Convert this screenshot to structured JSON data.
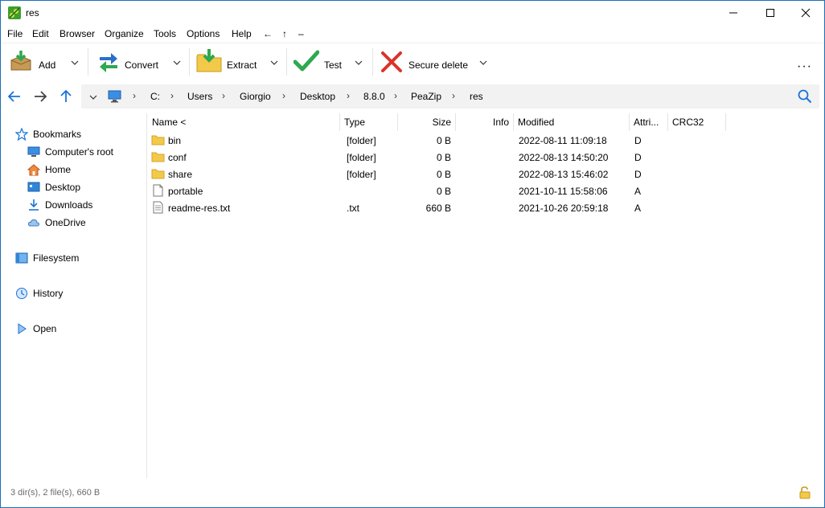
{
  "window": {
    "title": "res"
  },
  "menu": [
    "File",
    "Edit",
    "Browser",
    "Organize",
    "Tools",
    "Options",
    "Help",
    "←",
    "↑",
    "–"
  ],
  "toolbar": {
    "add": "Add",
    "convert": "Convert",
    "extract": "Extract",
    "test": "Test",
    "secure_delete": "Secure delete",
    "more": "···"
  },
  "address": {
    "crumbs": [
      "C:",
      "Users",
      "Giorgio",
      "Desktop",
      "8.8.0",
      "PeaZip",
      "res"
    ]
  },
  "sidebar": {
    "bookmarks": "Bookmarks",
    "items": [
      "Computer's root",
      "Home",
      "Desktop",
      "Downloads",
      "OneDrive"
    ],
    "filesystem": "Filesystem",
    "history": "History",
    "open": "Open"
  },
  "columns": {
    "name": "Name <",
    "type": "Type",
    "size": "Size",
    "info": "Info",
    "modified": "Modified",
    "attri": "Attri...",
    "crc32": "CRC32"
  },
  "files": [
    {
      "name": "bin",
      "type": "[folder]",
      "size": "0 B",
      "info": "",
      "modified": "2022-08-11 11:09:18",
      "attr": "D",
      "icon": "folder-icon"
    },
    {
      "name": "conf",
      "type": "[folder]",
      "size": "0 B",
      "info": "",
      "modified": "2022-08-13 14:50:20",
      "attr": "D",
      "icon": "folder-icon"
    },
    {
      "name": "share",
      "type": "[folder]",
      "size": "0 B",
      "info": "",
      "modified": "2022-08-13 15:46:02",
      "attr": "D",
      "icon": "folder-icon"
    },
    {
      "name": "portable",
      "type": "",
      "size": "0 B",
      "info": "",
      "modified": "2021-10-11 15:58:06",
      "attr": "A",
      "icon": "file-icon"
    },
    {
      "name": "readme-res.txt",
      "type": ".txt",
      "size": "660 B",
      "info": "",
      "modified": "2021-10-26 20:59:18",
      "attr": "A",
      "icon": "text-file-icon"
    }
  ],
  "status": {
    "text": "3 dir(s), 2 file(s), 660 B"
  },
  "colors": {
    "accent": "#1e6fb8",
    "folder": "#f3c94a",
    "green": "#2fa84f",
    "red": "#d9342b"
  }
}
